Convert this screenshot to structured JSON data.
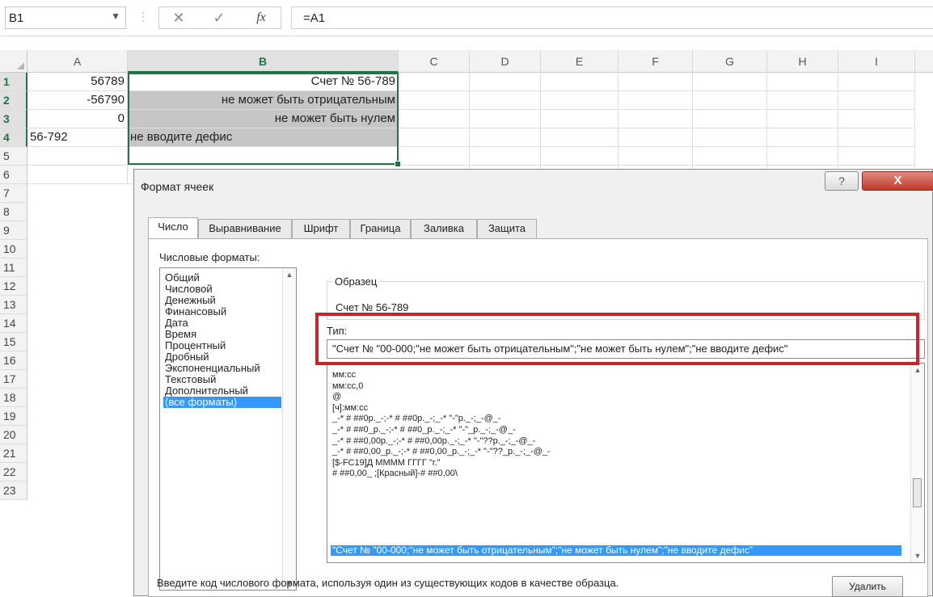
{
  "formula_bar": {
    "name_box": "B1",
    "cancel_icon": "✕",
    "enter_icon": "✓",
    "fx_icon": "fx",
    "formula": "=A1"
  },
  "columns": [
    "A",
    "B",
    "C",
    "D",
    "E",
    "F",
    "G",
    "H",
    "I"
  ],
  "rows": [
    "1",
    "2",
    "3",
    "4",
    "5",
    "6",
    "7",
    "8",
    "9",
    "10",
    "11",
    "12",
    "13",
    "14",
    "15",
    "16",
    "17",
    "18",
    "19",
    "20",
    "21",
    "22",
    "23"
  ],
  "cells": {
    "A1": "56789",
    "A2": "-56790",
    "A3": "0",
    "A4": "56-792",
    "B1": "Счет № 56-789",
    "B2": "не может быть отрицательным",
    "B3": "не может быть нулем",
    "B4": "не вводите дефис"
  },
  "dialog": {
    "title": "Формат ячеек",
    "help_icon": "?",
    "close_icon": "X",
    "tabs": [
      "Число",
      "Выравнивание",
      "Шрифт",
      "Граница",
      "Заливка",
      "Защита"
    ],
    "categories_label": "Числовые форматы:",
    "categories": [
      "Общий",
      "Числовой",
      "Денежный",
      "Финансовый",
      "Дата",
      "Время",
      "Процентный",
      "Дробный",
      "Экспоненциальный",
      "Текстовый",
      "Дополнительный",
      "(все форматы)"
    ],
    "sample_label": "Образец",
    "sample_value": "Счет № 56-789",
    "type_label": "Тип:",
    "type_value": "\"Счет № \"00-000;\"не может быть отрицательным\";\"не может быть нулем\";\"не вводите дефис\"",
    "formats": [
      "мм:сс",
      "мм:сс,0",
      "@",
      "[ч]:мм:сс",
      "_-* # ##0р._-;-* # ##0р._-;_-* \"-\"р._-;_-@_-",
      "_-* # ##0_р._-;-* # ##0_р._-;_-* \"-\"_р._-;_-@_-",
      "_-* # ##0,00р._-;-* # ##0,00р._-;_-* \"-\"??р._-;_-@_-",
      "_-* # ##0,00_р._-;-* # ##0,00_р._-;_-* \"-\"??_р._-;_-@_-",
      "[$-FC19]Д ММММ ГГГГ \"г.\"",
      "# ##0,00_ ;[Красный]-# ##0,00\\ ",
      "\"Счет № \"00-000;\"не может быть отрицательным\";\"не может быть нулем\";\"не вводите дефис\""
    ],
    "delete_button": "Удалить",
    "hint": "Введите код числового формата, используя один из существующих кодов в качестве образца."
  }
}
